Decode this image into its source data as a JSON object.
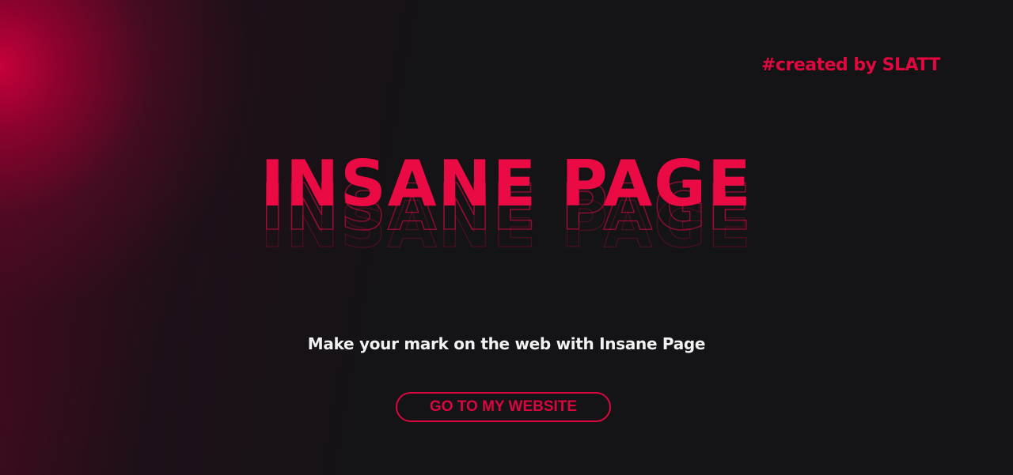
{
  "credit": {
    "text": "#created by SLATT"
  },
  "hero": {
    "title": "INSANE PAGE"
  },
  "tagline": {
    "text": "Make your mark on the web with Insane Page"
  },
  "cta": {
    "label": "GO TO MY WEBSITE"
  },
  "colors": {
    "accent": "#ea0b45",
    "background": "#141316",
    "tagline": "#f2f2f2",
    "glow": "#cd003c"
  }
}
